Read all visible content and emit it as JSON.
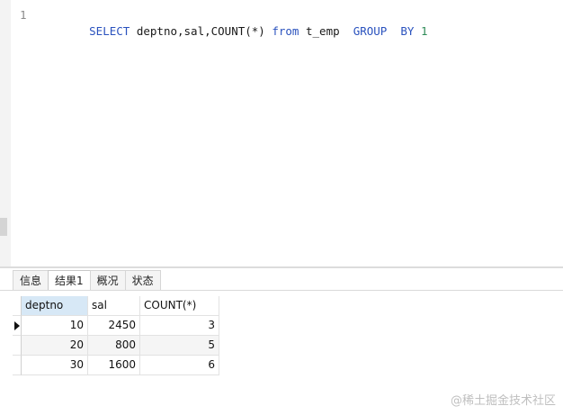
{
  "editor": {
    "line_number": "1",
    "tokens": [
      {
        "text": "SELECT",
        "cls": "kw"
      },
      {
        "text": " deptno,sal,COUNT(*) ",
        "cls": "ident"
      },
      {
        "text": "from",
        "cls": "kw"
      },
      {
        "text": " t_emp  ",
        "cls": "ident"
      },
      {
        "text": "GROUP",
        "cls": "kw"
      },
      {
        "text": "  ",
        "cls": "ident"
      },
      {
        "text": "BY",
        "cls": "kw"
      },
      {
        "text": " ",
        "cls": "ident"
      },
      {
        "text": "1",
        "cls": "num"
      }
    ]
  },
  "tabs": [
    {
      "label": "信息",
      "active": false
    },
    {
      "label": "结果1",
      "active": true
    },
    {
      "label": "概况",
      "active": false
    },
    {
      "label": "状态",
      "active": false
    }
  ],
  "results": {
    "columns": [
      "deptno",
      "sal",
      "COUNT(*)"
    ],
    "rows": [
      [
        "10",
        "2450",
        "3"
      ],
      [
        "20",
        "800",
        "5"
      ],
      [
        "30",
        "1600",
        "6"
      ]
    ]
  },
  "watermark": "@稀土掘金技术社区"
}
